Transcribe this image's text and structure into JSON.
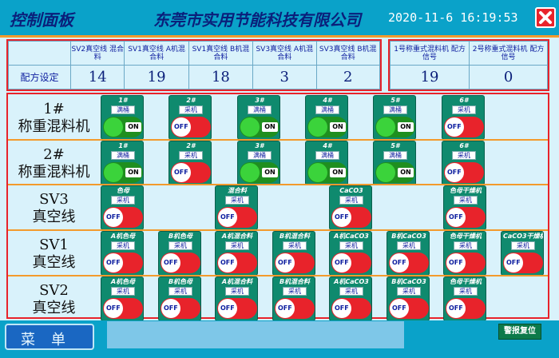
{
  "header": {
    "left_title": "控制面板",
    "center_title": "东莞市实用节能科技有限公司",
    "datetime": "2020-11-6 16:19:53",
    "close_icon": "close-x-icon",
    "colors": {
      "header_bg": "#0aa2c9",
      "title_text": "#0b1f7a",
      "accent_line": "#f39a2c",
      "close": "#e8232b"
    }
  },
  "recipe": {
    "row_label": "配方设定",
    "columns": [
      {
        "name": "SV2真空线 混合料",
        "value": "14"
      },
      {
        "name": "SV1真空线 A机混合料",
        "value": "19"
      },
      {
        "name": "SV1真空线 B机混合料",
        "value": "18"
      },
      {
        "name": "SV3真空线 A机混合料",
        "value": "3"
      },
      {
        "name": "SV3真空线 B机混合料",
        "value": "2"
      }
    ],
    "weigher_columns": [
      {
        "name": "1号称重式混料机 配方信号",
        "value": "19"
      },
      {
        "name": "2号称重式混料机 配方信号",
        "value": "0"
      }
    ]
  },
  "rows": [
    {
      "label": "1# 称重混料机",
      "switches": [
        {
          "title": "1#",
          "state": "满桶",
          "toggle": "ON"
        },
        {
          "title": "2#",
          "state": "采机",
          "toggle": "OFF"
        },
        {
          "title": "3#",
          "state": "满桶",
          "toggle": "ON"
        },
        {
          "title": "4#",
          "state": "满桶",
          "toggle": "ON"
        },
        {
          "title": "5#",
          "state": "满桶",
          "toggle": "ON"
        },
        {
          "title": "6#",
          "state": "采机",
          "toggle": "OFF"
        }
      ]
    },
    {
      "label": "2# 称重混料机",
      "switches": [
        {
          "title": "1#",
          "state": "满桶",
          "toggle": "ON"
        },
        {
          "title": "2#",
          "state": "采机",
          "toggle": "OFF"
        },
        {
          "title": "3#",
          "state": "满桶",
          "toggle": "ON"
        },
        {
          "title": "4#",
          "state": "满桶",
          "toggle": "ON"
        },
        {
          "title": "5#",
          "state": "满桶",
          "toggle": "ON"
        },
        {
          "title": "6#",
          "state": "采机",
          "toggle": "OFF"
        }
      ]
    },
    {
      "label": "SV3 真空线",
      "switches": [
        {
          "title": "色母",
          "state": "采机",
          "toggle": "OFF"
        },
        {
          "title": "混合料",
          "state": "采机",
          "toggle": "OFF"
        },
        {
          "title": "CaCO3",
          "state": "采机",
          "toggle": "OFF"
        },
        {
          "title": "色母干燥机",
          "state": "采机",
          "toggle": "OFF"
        }
      ]
    },
    {
      "label": "SV1 真空线",
      "switches": [
        {
          "title": "A机色母",
          "state": "采机",
          "toggle": "OFF"
        },
        {
          "title": "B机色母",
          "state": "采机",
          "toggle": "OFF"
        },
        {
          "title": "A机混合料",
          "state": "采机",
          "toggle": "OFF"
        },
        {
          "title": "B机混合料",
          "state": "采机",
          "toggle": "OFF"
        },
        {
          "title": "A机CaCO3",
          "state": "采机",
          "toggle": "OFF"
        },
        {
          "title": "B机CaCO3",
          "state": "采机",
          "toggle": "OFF"
        },
        {
          "title": "色母干燥机",
          "state": "采机",
          "toggle": "OFF"
        },
        {
          "title": "CaCO3干燥机",
          "state": "采机",
          "toggle": "OFF"
        }
      ]
    },
    {
      "label": "SV2 真空线",
      "switches": [
        {
          "title": "A机色母",
          "state": "采机",
          "toggle": "OFF"
        },
        {
          "title": "B机色母",
          "state": "采机",
          "toggle": "OFF"
        },
        {
          "title": "A机混合料",
          "state": "采机",
          "toggle": "OFF"
        },
        {
          "title": "B机混合料",
          "state": "采机",
          "toggle": "OFF"
        },
        {
          "title": "A机CaCO3",
          "state": "采机",
          "toggle": "OFF"
        },
        {
          "title": "B机CaCO3",
          "state": "采机",
          "toggle": "OFF"
        },
        {
          "title": "色母干燥机",
          "state": "采机",
          "toggle": "OFF"
        }
      ]
    }
  ],
  "footer": {
    "menu_label": "菜单",
    "alarm_reset_label": "警报复位"
  }
}
